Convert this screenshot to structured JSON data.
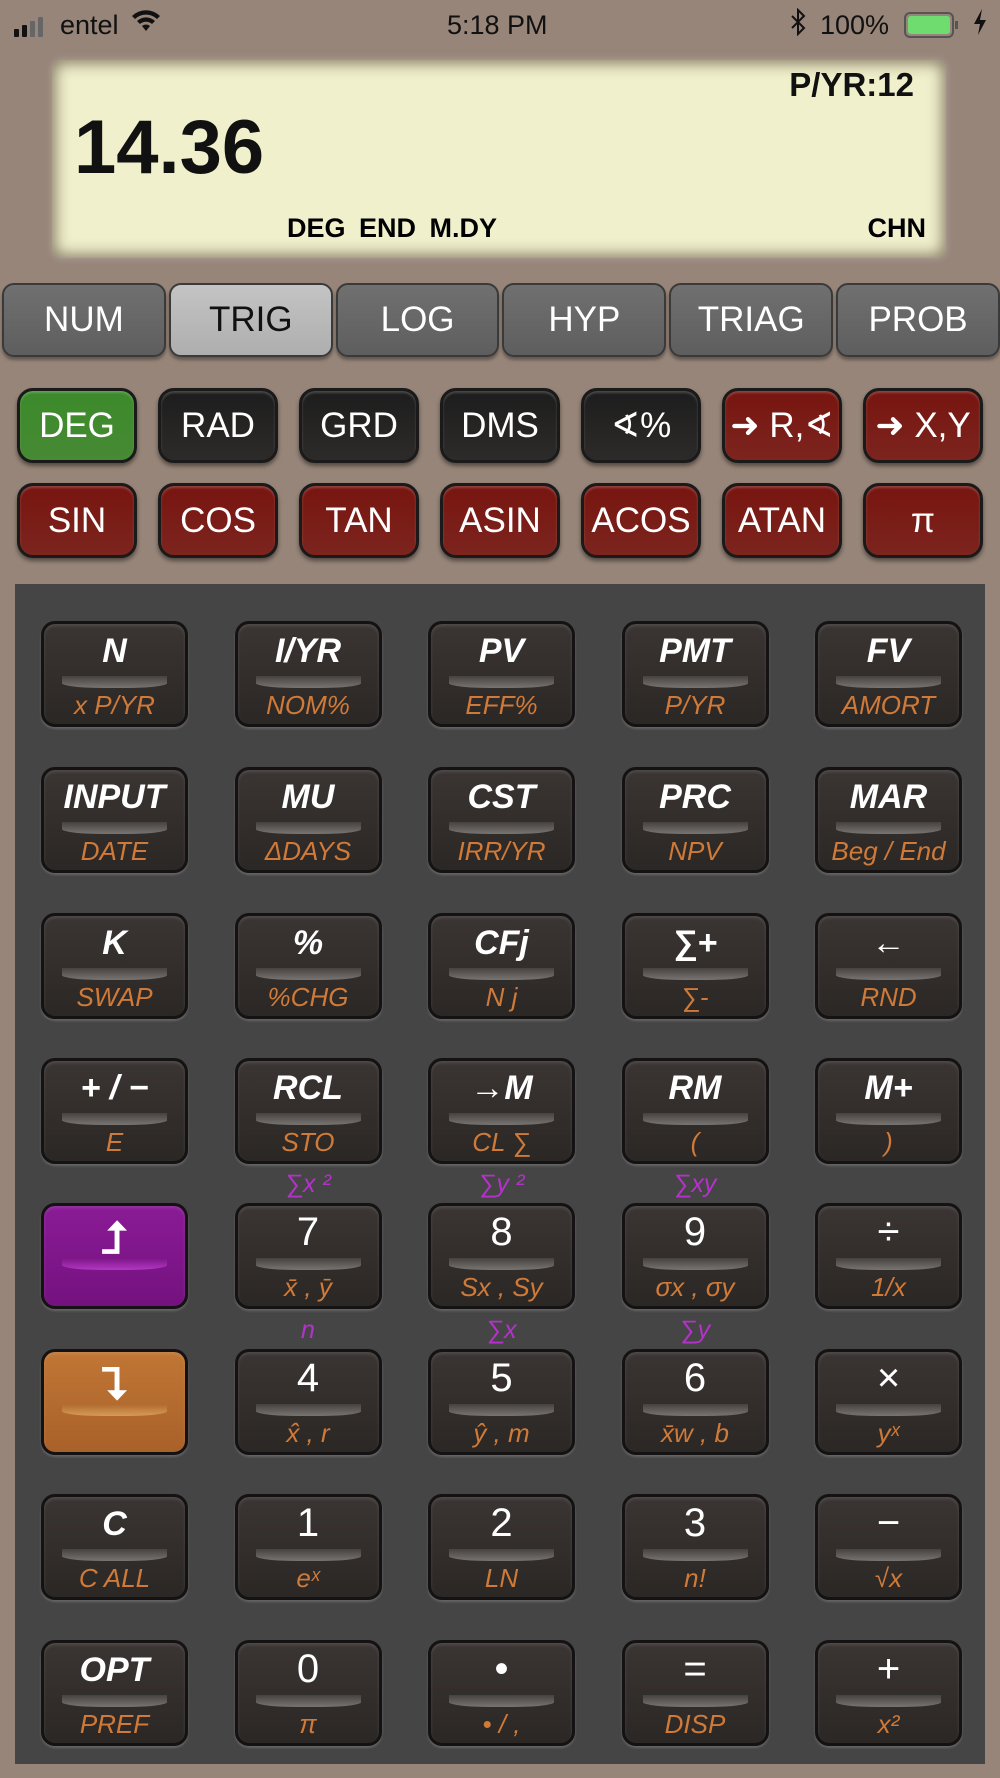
{
  "status_bar": {
    "carrier": "entel",
    "time": "5:18 PM",
    "battery": "100%",
    "battery_level": 1.0,
    "battery_color": "#6fdc6f"
  },
  "display": {
    "value": "14.36",
    "pyr": "P/YR:12",
    "annunciators": "DEG END M.DY",
    "chain_mode": "CHN"
  },
  "tabs": [
    {
      "label": "NUM"
    },
    {
      "label": "TRIG",
      "selected": true
    },
    {
      "label": "LOG"
    },
    {
      "label": "HYP"
    },
    {
      "label": "TRIAG"
    },
    {
      "label": "PROB"
    }
  ],
  "colors": {
    "green": "#3b8a2a",
    "black": "#1d1d1d",
    "red": "#781510",
    "purple": "#7a1585",
    "orange": "#b2682a",
    "sub_label": "#cf7a38",
    "above_label": "#b531cc"
  },
  "func_rows": [
    [
      {
        "label": "DEG",
        "color": "green"
      },
      {
        "label": "RAD",
        "color": "black"
      },
      {
        "label": "GRD",
        "color": "black"
      },
      {
        "label": "DMS",
        "color": "black"
      },
      {
        "label": "∢%",
        "color": "black"
      },
      {
        "label": "➜ R,∢",
        "color": "red"
      },
      {
        "label": "➜ X,Y",
        "color": "red"
      }
    ],
    [
      {
        "label": "SIN",
        "color": "red"
      },
      {
        "label": "COS",
        "color": "red"
      },
      {
        "label": "TAN",
        "color": "red"
      },
      {
        "label": "ASIN",
        "color": "red"
      },
      {
        "label": "ACOS",
        "color": "red"
      },
      {
        "label": "ATAN",
        "color": "red"
      },
      {
        "label": "π",
        "color": "red"
      }
    ]
  ],
  "keypad": [
    [
      {
        "main": "N",
        "sub": "x P/YR"
      },
      {
        "main": "I/YR",
        "sub": "NOM%"
      },
      {
        "main": "PV",
        "sub": "EFF%"
      },
      {
        "main": "PMT",
        "sub": "P/YR"
      },
      {
        "main": "FV",
        "sub": "AMORT"
      }
    ],
    [
      {
        "main": "INPUT",
        "sub": "DATE"
      },
      {
        "main": "MU",
        "sub": "ΔDAYS"
      },
      {
        "main": "CST",
        "sub": "IRR/YR"
      },
      {
        "main": "PRC",
        "sub": "NPV"
      },
      {
        "main": "MAR",
        "sub": "Beg / End"
      }
    ],
    [
      {
        "main": "K",
        "sub": "SWAP"
      },
      {
        "main": "%",
        "sub": "%CHG"
      },
      {
        "main": "CFj",
        "sub": "N j"
      },
      {
        "main": "∑+",
        "sub": "∑-"
      },
      {
        "main": "←",
        "sub": "RND"
      }
    ],
    [
      {
        "main": "+ / −",
        "sub": "E"
      },
      {
        "main": "RCL",
        "sub": "STO"
      },
      {
        "main": "→M",
        "sub": "CL ∑"
      },
      {
        "main": "RM",
        "sub": "("
      },
      {
        "main": "M+",
        "sub": ")"
      }
    ],
    [
      {
        "main": "⮥",
        "sub": "",
        "shift": "purple",
        "name": "shift-up"
      },
      {
        "main": "7",
        "sub": "x̄ , ȳ",
        "above": "∑x ²"
      },
      {
        "main": "8",
        "sub": "Sx , Sy",
        "above": "∑y ²"
      },
      {
        "main": "9",
        "sub": "σx , σy",
        "above": "∑xy"
      },
      {
        "main": "÷",
        "sub": "1/x"
      }
    ],
    [
      {
        "main": "⮧",
        "sub": "",
        "shift": "orange",
        "name": "shift-down"
      },
      {
        "main": "4",
        "sub": "x̂ , r",
        "above": "n"
      },
      {
        "main": "5",
        "sub": "ŷ , m",
        "above": "∑x"
      },
      {
        "main": "6",
        "sub": "x̄w , b",
        "above": "∑y"
      },
      {
        "main": "×",
        "sub": "yˣ"
      }
    ],
    [
      {
        "main": "C",
        "sub": "C ALL"
      },
      {
        "main": "1",
        "sub": "eˣ"
      },
      {
        "main": "2",
        "sub": "LN"
      },
      {
        "main": "3",
        "sub": "n!"
      },
      {
        "main": "−",
        "sub": "√x"
      }
    ],
    [
      {
        "main": "OPT",
        "sub": "PREF"
      },
      {
        "main": "0",
        "sub": "π"
      },
      {
        "main": "•",
        "sub": "• / ,"
      },
      {
        "main": "=",
        "sub": "DISP"
      },
      {
        "main": "+",
        "sub": "x²"
      }
    ]
  ]
}
